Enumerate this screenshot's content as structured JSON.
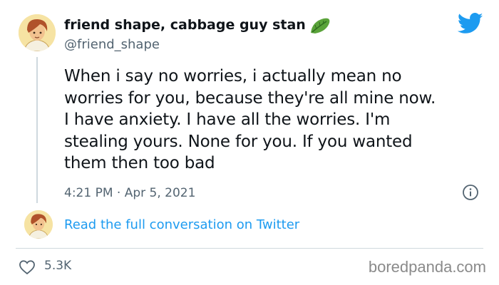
{
  "author": {
    "display_name": "friend shape, cabbage guy stan",
    "name_emoji": "leafy-green-emoji",
    "handle": "@friend_shape"
  },
  "tweet": {
    "text": "When i say no worries, i actually mean no\nworries for you, because they're all mine now.\nI have anxiety. I have all the worries. I'm\nstealing yours. None for you. If you wanted\nthem then too bad",
    "timestamp": "4:21 PM · Apr 5, 2021"
  },
  "conversation_link": "Read the full conversation on Twitter",
  "engagement": {
    "likes": "5.3K"
  },
  "watermark": "boredpanda.com",
  "colors": {
    "link": "#1d9bf0",
    "twitter_blue": "#1d9bf0",
    "secondary_text": "#536471",
    "avatar_bg": "#f6e3a3"
  },
  "icons": [
    "twitter-bird-icon",
    "info-icon",
    "heart-icon",
    "leafy-green-emoji"
  ]
}
